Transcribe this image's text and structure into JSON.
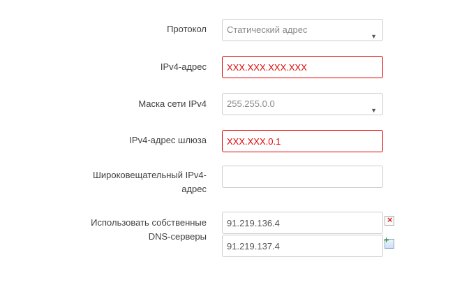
{
  "protocol": {
    "label": "Протокол",
    "value": "Статический адрес"
  },
  "ipv4_address": {
    "label": "IPv4-адрес",
    "value": "XXX.XXX.XXX.XXX"
  },
  "ipv4_netmask": {
    "label": "Маска сети IPv4",
    "value": "255.255.0.0"
  },
  "ipv4_gateway": {
    "label": "IPv4-адрес шлюза",
    "value": "XXX.XXX.0.1"
  },
  "ipv4_broadcast": {
    "label_line1": "Широковещательный IPv4-",
    "label_line2": "адрес",
    "value": ""
  },
  "dns": {
    "label_line1": "Использовать собственные",
    "label_line2": "DNS-серверы",
    "servers": [
      "91.219.136.4",
      "91.219.137.4"
    ],
    "remove_icon": "remove-icon",
    "add_icon": "add-icon"
  },
  "colors": {
    "error": "#e00000",
    "border": "#cccccc",
    "text": "#404040"
  }
}
